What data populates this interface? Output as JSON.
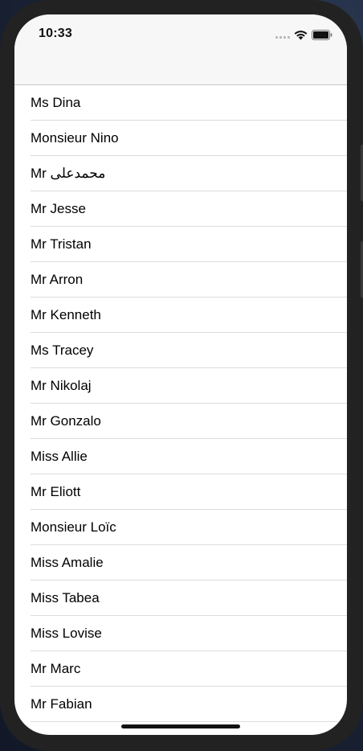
{
  "status_bar": {
    "time": "10:33",
    "icons": [
      "cellular-signal-icon",
      "wifi-icon",
      "battery-icon"
    ]
  },
  "colors": {
    "nav_background": "#f7f7f7",
    "separator": "#dcdce0",
    "text": "#000000",
    "frame": "#222222"
  },
  "list": {
    "items": [
      {
        "label": "Ms Dina"
      },
      {
        "label": "Monsieur Nino"
      },
      {
        "label": "Mr محمدعلی"
      },
      {
        "label": "Mr Jesse"
      },
      {
        "label": "Mr Tristan"
      },
      {
        "label": "Mr Arron"
      },
      {
        "label": "Mr Kenneth"
      },
      {
        "label": "Ms Tracey"
      },
      {
        "label": "Mr Nikolaj"
      },
      {
        "label": "Mr Gonzalo"
      },
      {
        "label": "Miss Allie"
      },
      {
        "label": "Mr Eliott"
      },
      {
        "label": "Monsieur Loïc"
      },
      {
        "label": "Miss Amalie"
      },
      {
        "label": "Miss Tabea"
      },
      {
        "label": "Miss Lovise"
      },
      {
        "label": "Mr Marc"
      },
      {
        "label": "Mr Fabian"
      }
    ]
  }
}
